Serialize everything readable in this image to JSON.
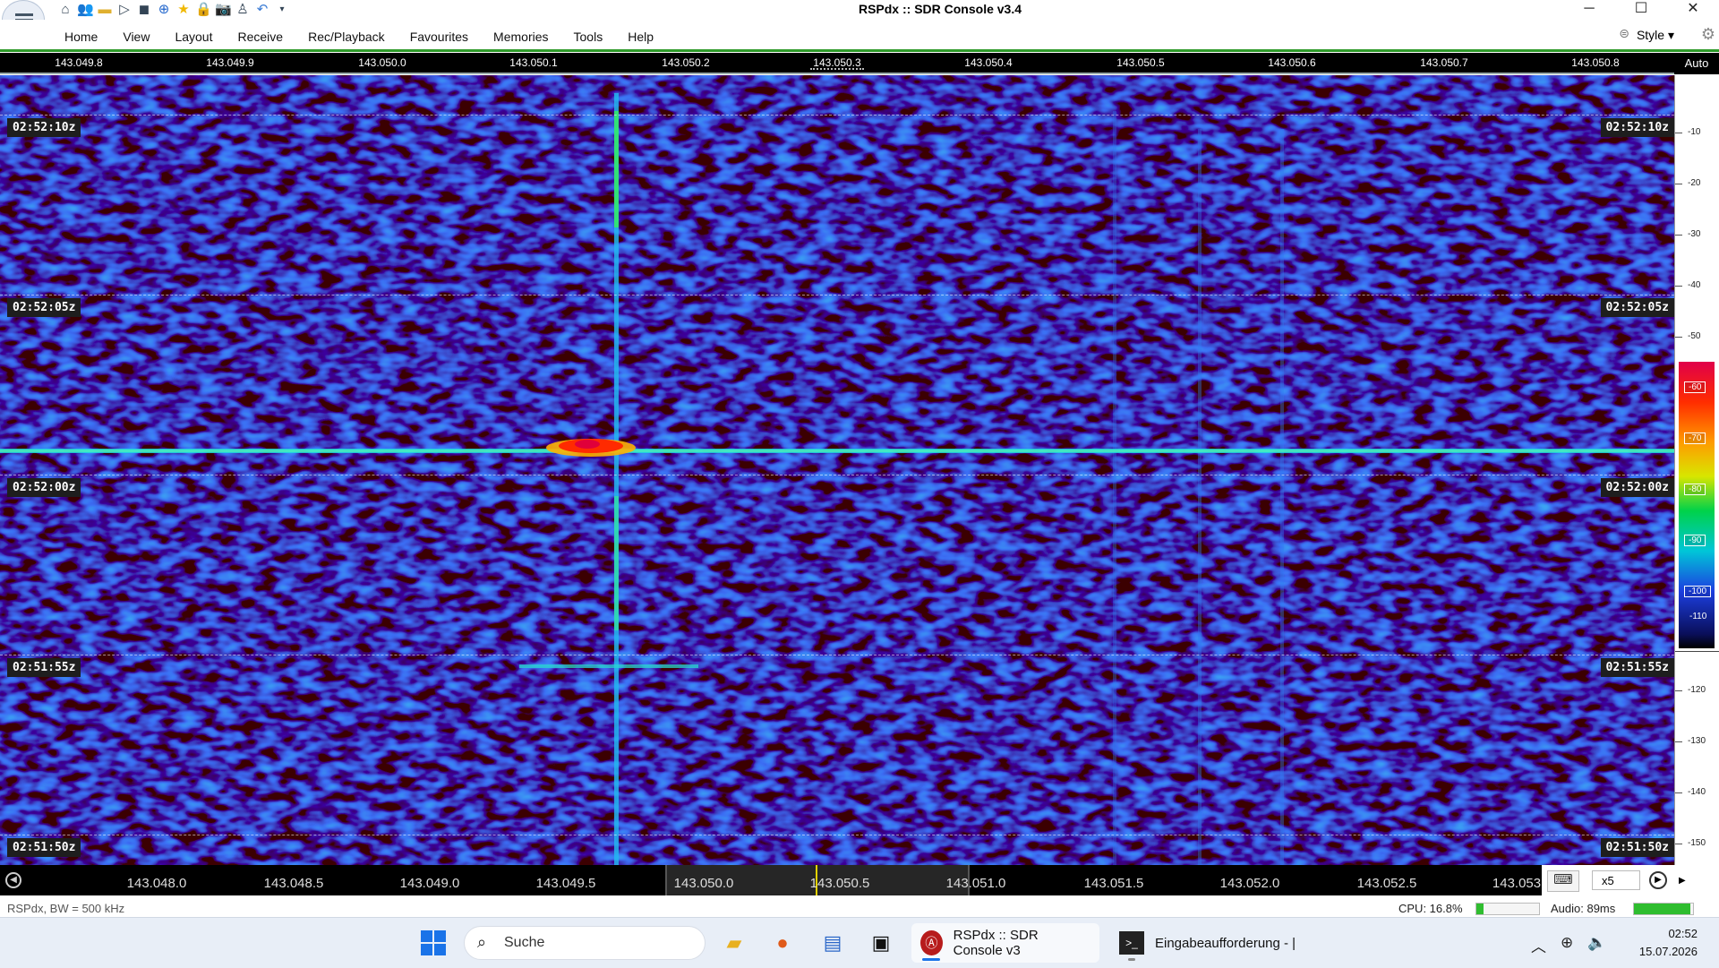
{
  "window": {
    "title": "RSPdx :: SDR Console v3.4",
    "controls": [
      "minimize-icon",
      "maximize-icon",
      "close-icon"
    ]
  },
  "quick_access": [
    "home-icon",
    "users-icon",
    "folder-icon",
    "play-icon",
    "stop-icon",
    "add-icon",
    "star-icon",
    "lock-icon",
    "camera-icon",
    "person-icon",
    "undo-icon",
    "dropdown-icon"
  ],
  "menu": {
    "items": [
      "Home",
      "View",
      "Layout",
      "Receive",
      "Rec/Playback",
      "Favourites",
      "Memories",
      "Tools",
      "Help"
    ],
    "style_label": "Style"
  },
  "top_scale": {
    "ticks": [
      "143.049.8",
      "143.049.9",
      "143.050.0",
      "143.050.1",
      "143.050.2",
      "143.050.3",
      "143.050.4",
      "143.050.5",
      "143.050.6",
      "143.050.7",
      "143.050.8"
    ],
    "auto_label": "Auto"
  },
  "waterfall": {
    "time_labels": [
      "02:52:10z",
      "02:52:05z",
      "02:52:00z",
      "02:51:55z",
      "02:51:50z"
    ]
  },
  "db_scale": {
    "ticks": [
      "-10",
      "-20",
      "-30",
      "-40",
      "-50",
      "-60",
      "-70",
      "-80",
      "-90",
      "-100",
      "-110",
      "-120",
      "-130",
      "-140",
      "-150"
    ],
    "colorbar_labels": [
      "-60",
      "-70",
      "-80",
      "-90",
      "-100",
      "-110"
    ]
  },
  "bottom_scale": {
    "ticks": [
      "143.048.0",
      "143.048.5",
      "143.049.0",
      "143.049.5",
      "143.050.0",
      "143.050.5",
      "143.051.0",
      "143.051.5",
      "143.052.0",
      "143.052.5",
      "143.053"
    ],
    "zoom": "x5"
  },
  "status": {
    "left": "RSPdx, BW = 500 kHz",
    "cpu": "CPU: 16.8%",
    "cpu_level": 0.12,
    "audio": "Audio: 89ms",
    "audio_level": 0.95
  },
  "taskbar": {
    "search_placeholder": "Suche",
    "apps": [
      {
        "label": "RSPdx :: SDR Console v3",
        "icon": "sdr-console-icon"
      },
      {
        "label": "Eingabeaufforderung - |",
        "icon": "terminal-icon"
      }
    ],
    "time": "02:52",
    "date": "15.07.2026"
  }
}
